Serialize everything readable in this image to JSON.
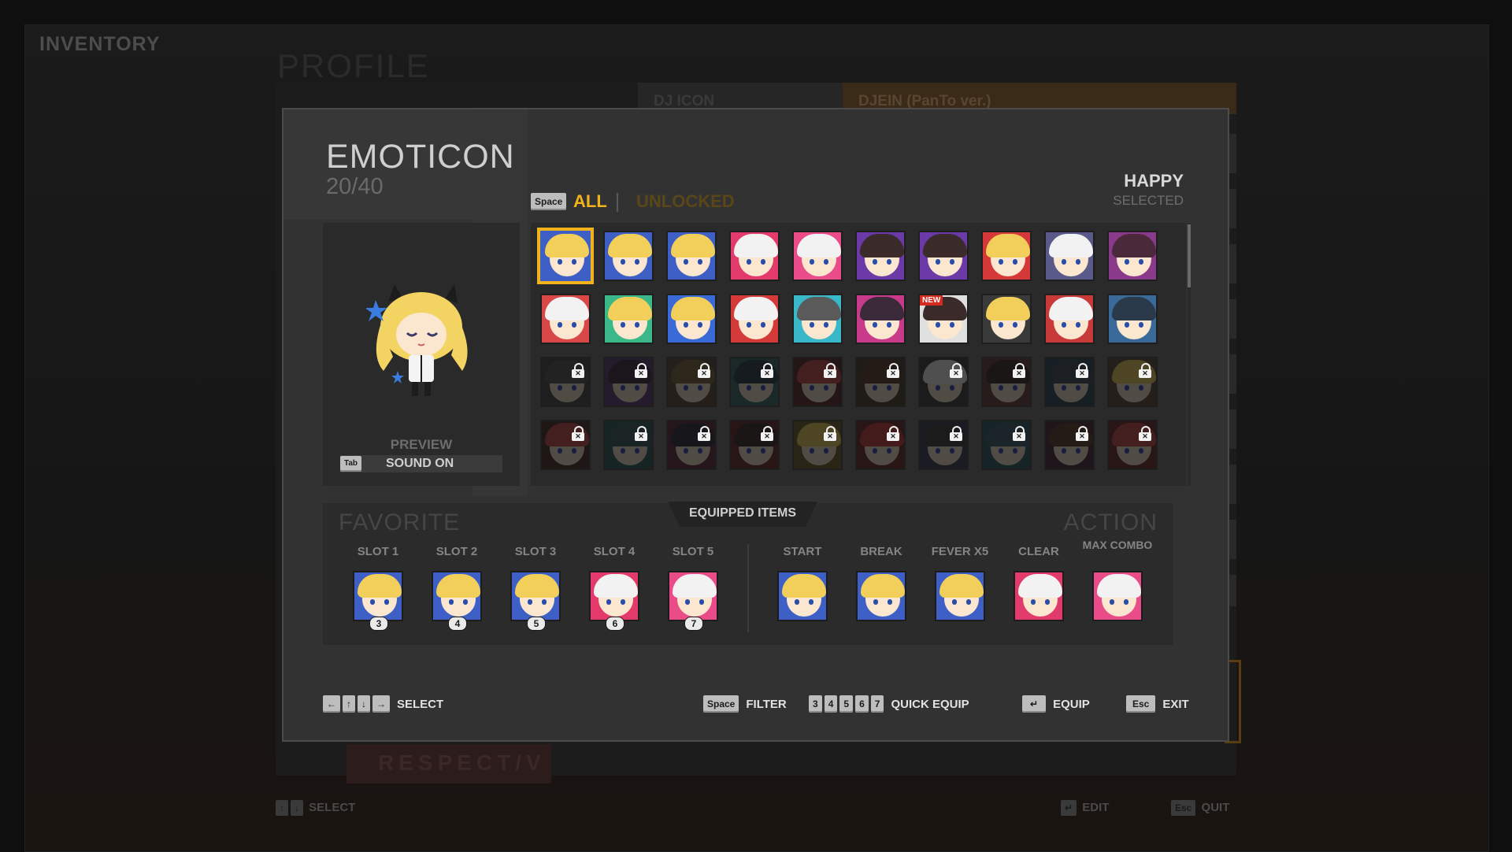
{
  "background": {
    "title": "INVENTORY",
    "profile": "PROFILE",
    "dj_icon": "DJ ICON",
    "dj_name": "DJEIN (PanTo ver.)",
    "respect": "RESPECT/V",
    "hints": {
      "select_label": "SELECT",
      "edit_label": "EDIT",
      "quit_label": "QUIT",
      "esc_key": "Esc"
    }
  },
  "modal": {
    "title": "EMOTICON",
    "count": "20/40",
    "filter_key": "Space",
    "tabs": {
      "all": "ALL",
      "unlocked": "UNLOCKED",
      "active": "ALL"
    },
    "selected_name": "HAPPY",
    "selected_status": "SELECTED",
    "preview": {
      "label": "PREVIEW",
      "sound_key": "Tab",
      "sound_label": "SOUND ON"
    },
    "grid": {
      "columns": 10,
      "selected_index": 0,
      "new_badge": "NEW",
      "items": [
        {
          "hair": "#f1cf5a",
          "bg": "#3d5fc6",
          "locked": false
        },
        {
          "hair": "#f1cf5a",
          "bg": "#3d5fc6",
          "locked": false
        },
        {
          "hair": "#f1cf5a",
          "bg": "#3d5fc6",
          "locked": false
        },
        {
          "hair": "#f2f2f2",
          "bg": "#e23a6a",
          "locked": false
        },
        {
          "hair": "#f2f2f2",
          "bg": "#ea4c8a",
          "locked": false
        },
        {
          "hair": "#3a2a2a",
          "bg": "#6b3aa8",
          "locked": false
        },
        {
          "hair": "#3a2a2a",
          "bg": "#6b3aa8",
          "locked": false
        },
        {
          "hair": "#f1cf5a",
          "bg": "#d43838",
          "locked": false
        },
        {
          "hair": "#f2f2f2",
          "bg": "#5a5a8a",
          "locked": false
        },
        {
          "hair": "#4a2a3a",
          "bg": "#8a3a8a",
          "locked": false
        },
        {
          "hair": "#f2f2f2",
          "bg": "#d84848",
          "locked": false
        },
        {
          "hair": "#f1cf5a",
          "bg": "#3ab88a",
          "locked": false
        },
        {
          "hair": "#f1cf5a",
          "bg": "#3a6ad8",
          "locked": false
        },
        {
          "hair": "#f2f2f2",
          "bg": "#d43a3a",
          "locked": false
        },
        {
          "hair": "#5a5a5a",
          "bg": "#38b8c8",
          "locked": false
        },
        {
          "hair": "#3a2a3a",
          "bg": "#c83a8a",
          "locked": false
        },
        {
          "hair": "#3a2a2a",
          "bg": "#e0e0e0",
          "locked": false,
          "new": true
        },
        {
          "hair": "#f1cf5a",
          "bg": "#3a3a3a",
          "locked": false
        },
        {
          "hair": "#f2f2f2",
          "bg": "#c83a3a",
          "locked": false
        },
        {
          "hair": "#2a3a4a",
          "bg": "#3a6a9a",
          "locked": false
        },
        {
          "hair": "#555",
          "bg": "#444",
          "locked": true
        },
        {
          "hair": "#3a2a3a",
          "bg": "#5a3a7a",
          "locked": true
        },
        {
          "hair": "#7a6a3a",
          "bg": "#5a4a3a",
          "locked": true
        },
        {
          "hair": "#2a3a4a",
          "bg": "#3a6a6a",
          "locked": true
        },
        {
          "hair": "#c84848",
          "bg": "#5a2a2a",
          "locked": true
        },
        {
          "hair": "#5a3a2a",
          "bg": "#4a3a2a",
          "locked": true
        },
        {
          "hair": "#f2f2f2",
          "bg": "#3a3a3a",
          "locked": true
        },
        {
          "hair": "#3a2a2a",
          "bg": "#6a3a3a",
          "locked": true
        },
        {
          "hair": "#3a4a5a",
          "bg": "#2a4a5a",
          "locked": true
        },
        {
          "hair": "#f1cf5a",
          "bg": "#5a4a3a",
          "locked": true
        },
        {
          "hair": "#c84848",
          "bg": "#4a2a2a",
          "locked": true
        },
        {
          "hair": "#3a5a5a",
          "bg": "#2a5a5a",
          "locked": true
        },
        {
          "hair": "#2a2a3a",
          "bg": "#5a2a3a",
          "locked": true
        },
        {
          "hair": "#3a2a2a",
          "bg": "#6a2a2a",
          "locked": true
        },
        {
          "hair": "#f1cf5a",
          "bg": "#6a5a2a",
          "locked": true
        },
        {
          "hair": "#c83a3a",
          "bg": "#6a2a2a",
          "locked": true
        },
        {
          "hair": "#3a3a3a",
          "bg": "#3a3a5a",
          "locked": true
        },
        {
          "hair": "#3a5a6a",
          "bg": "#2a5a6a",
          "locked": true
        },
        {
          "hair": "#5a3a2a",
          "bg": "#4a2a3a",
          "locked": true
        },
        {
          "hair": "#c84848",
          "bg": "#6a2a2a",
          "locked": true
        }
      ]
    },
    "equipped": {
      "title": "EQUIPPED ITEMS",
      "favorite_title": "FAVORITE",
      "action_title": "ACTION",
      "favorite_slots": [
        {
          "label": "SLOT 1",
          "num": "3",
          "hair": "#f1cf5a",
          "bg": "#3d5fc6"
        },
        {
          "label": "SLOT 2",
          "num": "4",
          "hair": "#f1cf5a",
          "bg": "#3d5fc6"
        },
        {
          "label": "SLOT 3",
          "num": "5",
          "hair": "#f1cf5a",
          "bg": "#3d5fc6"
        },
        {
          "label": "SLOT 4",
          "num": "6",
          "hair": "#f2f2f2",
          "bg": "#e23a6a"
        },
        {
          "label": "SLOT 5",
          "num": "7",
          "hair": "#f2f2f2",
          "bg": "#ea4c8a"
        }
      ],
      "action_slots": [
        {
          "label": "START",
          "hair": "#f1cf5a",
          "bg": "#3d5fc6"
        },
        {
          "label": "BREAK",
          "hair": "#f1cf5a",
          "bg": "#3d5fc6"
        },
        {
          "label": "FEVER X5",
          "hair": "#f1cf5a",
          "bg": "#3d5fc6"
        },
        {
          "label": "CLEAR",
          "hair": "#f2f2f2",
          "bg": "#e23a6a"
        },
        {
          "label": "MAX COMBO",
          "hair": "#f2f2f2",
          "bg": "#ea4c8a"
        }
      ]
    },
    "controls": {
      "select": {
        "keys": [
          "←",
          "↑",
          "↓",
          "→"
        ],
        "label": "SELECT"
      },
      "filter": {
        "key": "Space",
        "label": "FILTER"
      },
      "quick_equip": {
        "keys": [
          "3",
          "4",
          "5",
          "6",
          "7"
        ],
        "label": "QUICK EQUIP"
      },
      "equip": {
        "key": "↵",
        "label": "EQUIP"
      },
      "exit": {
        "key": "Esc",
        "label": "EXIT"
      }
    }
  },
  "colors": {
    "accent": "#f2b21a",
    "modal_bg": "#323232",
    "panel_bg": "#2a2a2a"
  }
}
